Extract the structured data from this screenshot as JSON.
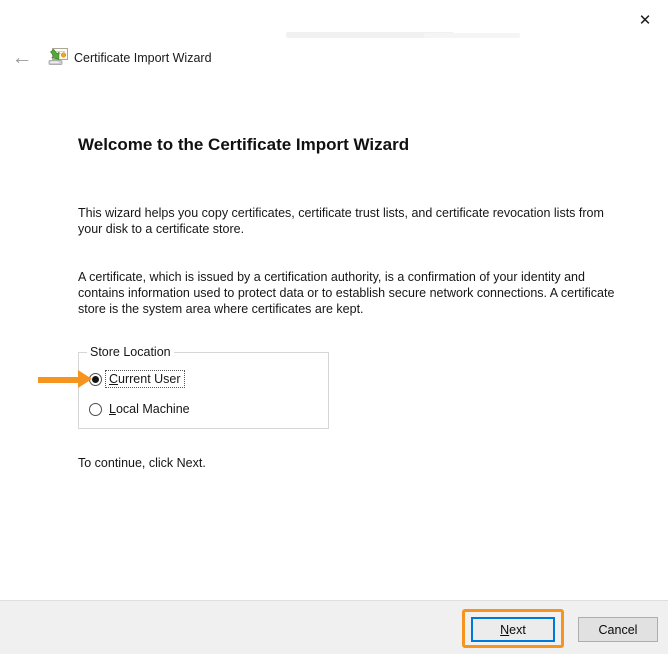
{
  "window": {
    "close_icon": "✕"
  },
  "header": {
    "back_icon": "←",
    "title": "Certificate Import Wizard"
  },
  "main": {
    "heading": "Welcome to the Certificate Import Wizard",
    "paragraph1": "This wizard helps you copy certificates, certificate trust lists, and certificate revocation lists from your disk to a certificate store.",
    "paragraph2": "A certificate, which is issued by a certification authority, is a confirmation of your identity and contains information used to protect data or to establish secure network connections. A certificate store is the system area where certificates are kept.",
    "store_location": {
      "legend": "Store Location",
      "options": [
        {
          "accel": "C",
          "rest": "urrent User",
          "selected": true
        },
        {
          "accel": "L",
          "rest": "ocal Machine",
          "selected": false
        }
      ]
    },
    "continue_hint": "To continue, click Next."
  },
  "footer": {
    "next_button": {
      "accel": "N",
      "rest": "ext"
    },
    "cancel_label": "Cancel"
  },
  "colors": {
    "annotation_orange": "#F5941F",
    "default_button_blue": "#0078D7",
    "button_face": "#E1E1E1",
    "footer_bg": "#F0F0F0"
  }
}
